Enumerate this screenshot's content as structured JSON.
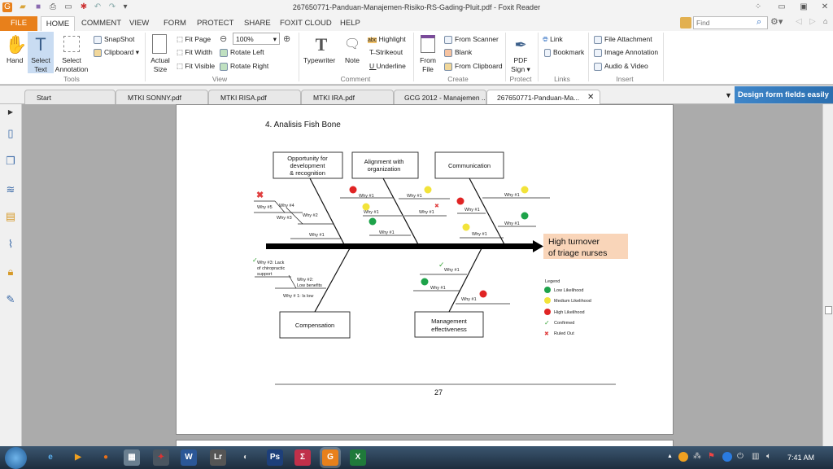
{
  "window": {
    "title": "267650771-Panduan-Manajemen-Risiko-RS-Gading-Pluit.pdf - Foxit Reader"
  },
  "menu": [
    "FILE",
    "HOME",
    "COMMENT",
    "VIEW",
    "FORM",
    "PROTECT",
    "SHARE",
    "FOXIT CLOUD",
    "HELP"
  ],
  "search": {
    "placeholder": "Find"
  },
  "ribbon": {
    "tools": {
      "hand": "Hand",
      "select_text": "Select Text",
      "select_annotation": "Select Annotation",
      "snapshot": "SnapShot",
      "clipboard": "Clipboard",
      "group": "Tools"
    },
    "view": {
      "actual_size": "Actual Size",
      "fit_page": "Fit Page",
      "fit_width": "Fit Width",
      "fit_visible": "Fit Visible",
      "zoom": "100%",
      "rotate_left": "Rotate Left",
      "rotate_right": "Rotate Right",
      "group": "View"
    },
    "comment": {
      "typewriter": "Typewriter",
      "note": "Note",
      "highlight": "Highlight",
      "strikeout": "Strikeout",
      "underline": "Underline",
      "group": "Comment"
    },
    "create": {
      "from_file": "From File",
      "from_scanner": "From Scanner",
      "blank": "Blank",
      "from_clipboard": "From Clipboard",
      "group": "Create"
    },
    "protect": {
      "pdf_sign": "PDF Sign",
      "group": "Protect"
    },
    "links": {
      "link": "Link",
      "bookmark": "Bookmark",
      "group": "Links"
    },
    "insert": {
      "file_attachment": "File Attachment",
      "image_annotation": "Image Annotation",
      "audio_video": "Audio & Video",
      "group": "Insert"
    }
  },
  "tabs": [
    "Start",
    "MTKI SONNY.pdf",
    "MTKI RISA.pdf",
    "MTKI IRA.pdf",
    "GCG 2012 - Manajemen ...",
    "267650771-Panduan-Ma..."
  ],
  "ad_banner": "Design form fields easily",
  "document": {
    "heading": "4.   Analisis Fish Bone",
    "page_number": "27",
    "diagram": {
      "effect": [
        "High turnover",
        "of triage nurses"
      ],
      "causes_top": [
        [
          "Opportunity for",
          "development",
          "& recognition"
        ],
        [
          "Alignment with",
          "organization"
        ],
        [
          "Communication"
        ]
      ],
      "causes_bottom": [
        [
          "Compensation"
        ],
        [
          "Management",
          "effectiveness"
        ]
      ],
      "whys": {
        "why1": "Why #1",
        "why2": "Why #2",
        "why3": "Why #3",
        "why4": "Why #4",
        "why5": "Why #5",
        "comp": [
          "Why #3: Lack",
          "of chiropractic",
          "support",
          "Why #2:",
          "Low benefits",
          "Why # 1: Is low"
        ]
      },
      "legend": {
        "title": "Legend",
        "items": [
          "Low Likelihood",
          "Medium Likelihood",
          "High Likelihood",
          "Confirmed",
          "Ruled Out"
        ]
      },
      "colors": {
        "low": "#1ea34a",
        "medium": "#f2e33a",
        "high": "#e02424",
        "confirmed": "#3aa53a",
        "ruled_out": "#e04040",
        "effect_bg": "#f9d5b9"
      }
    }
  },
  "taskbar": {
    "time": "7:41 AM"
  }
}
